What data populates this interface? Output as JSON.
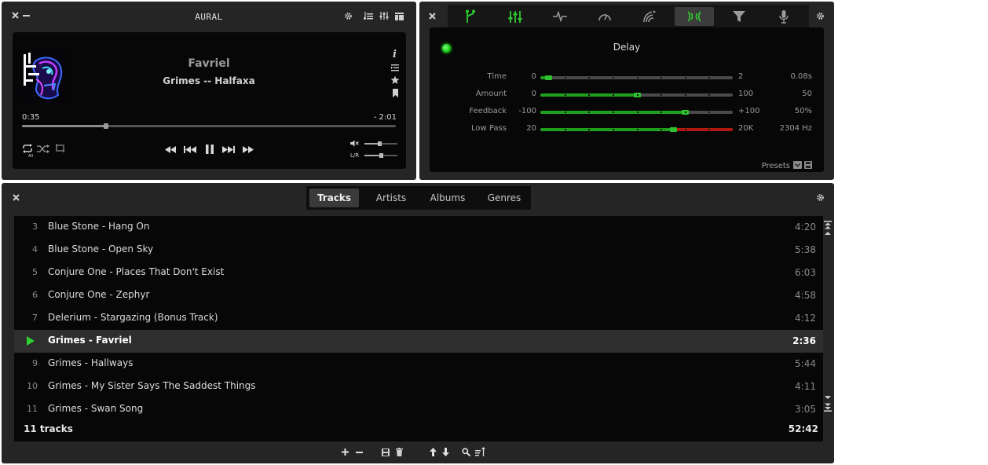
{
  "player": {
    "app_title": "AURAL",
    "track_title": "Favriel",
    "track_artist_album": "Grimes -- Halfaxa",
    "elapsed": "0:35",
    "remaining": "- 2:01",
    "progress": 0.225,
    "volume": 0.45,
    "balance": 0.5,
    "balance_label": "L/R",
    "repeat_badge": "All",
    "icons": [
      "close-icon",
      "minimize-icon",
      "gear-icon",
      "playlist-icon",
      "equalizer-icon",
      "layout-icon",
      "info-icon",
      "queue-icon",
      "star-icon",
      "bookmark-icon",
      "repeat-icon",
      "shuffle-icon",
      "ab-loop-icon",
      "rewind-icon",
      "previous-icon",
      "pause-icon",
      "next-icon",
      "fast-forward-icon",
      "volume-icon"
    ]
  },
  "effects": {
    "unit_name": "Delay",
    "enabled_color": "#22c822",
    "accent_color": "#2ecc2e",
    "tabs": [
      "master-icon",
      "eq-icon",
      "pitch-icon",
      "time-icon",
      "reverb-icon",
      "delay-icon",
      "filter-icon",
      "audio-units-icon"
    ],
    "selected_tab": 5,
    "params": [
      {
        "label": "Time",
        "min": "0",
        "max": "2",
        "value": "0.08s",
        "fill": 0.04
      },
      {
        "label": "Amount",
        "min": "0",
        "max": "100",
        "value": "50",
        "fill": 0.5
      },
      {
        "label": "Feedback",
        "min": "-100",
        "max": "+100",
        "value": "50%",
        "fill": 0.75
      },
      {
        "label": "Low Pass",
        "min": "20",
        "max": "20K",
        "value": "2304 Hz",
        "fill": 0.69
      }
    ],
    "presets_label": "Presets"
  },
  "playlist": {
    "tabs": [
      "Tracks",
      "Artists",
      "Albums",
      "Genres"
    ],
    "selected_tab": 0,
    "tracks": [
      {
        "num": "3",
        "name": "Blue Stone - Hang On",
        "duration": "4:20"
      },
      {
        "num": "4",
        "name": "Blue Stone - Open Sky",
        "duration": "5:38"
      },
      {
        "num": "5",
        "name": "Conjure One - Places That Don't Exist",
        "duration": "6:03"
      },
      {
        "num": "6",
        "name": "Conjure One - Zephyr",
        "duration": "4:58"
      },
      {
        "num": "7",
        "name": "Delerium - Stargazing (Bonus Track)",
        "duration": "4:12"
      },
      {
        "num": "",
        "name": "Grimes - Favriel",
        "duration": "2:36",
        "playing": true
      },
      {
        "num": "9",
        "name": "Grimes - Hallways",
        "duration": "5:44"
      },
      {
        "num": "10",
        "name": "Grimes - My Sister Says The Saddest Things",
        "duration": "4:11"
      },
      {
        "num": "11",
        "name": "Grimes - Swan Song",
        "duration": "3:05"
      }
    ],
    "summary_count": "11 tracks",
    "summary_total": "52:42"
  }
}
